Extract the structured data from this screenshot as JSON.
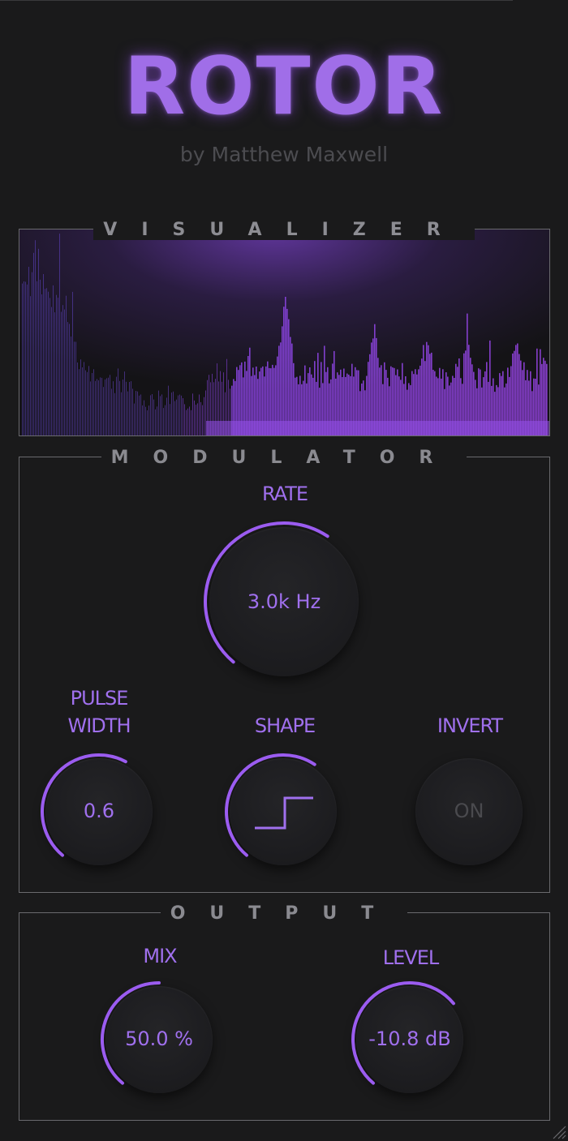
{
  "app": {
    "title": "ROTOR",
    "subtitle": "by Matthew Maxwell"
  },
  "sections": {
    "visualizer": "VISUALIZER",
    "modulator": "MODULATOR",
    "output": "OUTPUT"
  },
  "modulator": {
    "rate": {
      "label": "RATE",
      "value": "3.0k Hz",
      "level": 0.62
    },
    "pulse_width": {
      "label_line1": "PULSE",
      "label_line2": "WIDTH",
      "value": "0.6",
      "level": 0.6
    },
    "shape": {
      "label": "SHAPE",
      "value_icon": "square-wave-icon",
      "level": 0.62
    },
    "invert": {
      "label": "INVERT",
      "value": "ON",
      "level": 0.0
    }
  },
  "output": {
    "mix": {
      "label": "MIX",
      "value": "50.0 %",
      "level": 0.5
    },
    "level": {
      "label": "LEVEL",
      "value": "-10.8 dB",
      "level": 0.68
    }
  },
  "colors": {
    "accent": "#9b5cf0",
    "accent_text": "#a070ee",
    "background": "#1a1a1b",
    "border": "#6a6a6e",
    "dim_text": "#4c4c50"
  }
}
